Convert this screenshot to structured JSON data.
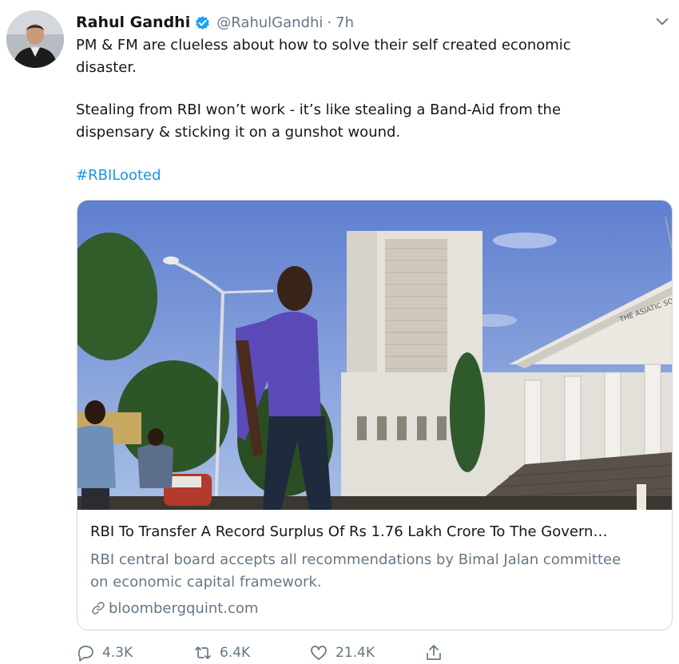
{
  "tweet": {
    "author_name": "Rahul Gandhi",
    "handle": "@RahulGandhi",
    "separator": "·",
    "time": "7h",
    "lines": [
      "PM & FM are clueless about how to solve their self created economic",
      "disaster.",
      "Stealing from RBI won’t work - it’s like stealing a Band-Aid from the",
      "dispensary & sticking it on a gunshot wound."
    ],
    "hashtag": "#RBILooted"
  },
  "card": {
    "title": "RBI To Transfer A Record Surplus Of Rs 1.76 Lakh Crore To The Govern…",
    "description_lines": [
      "RBI central board accepts all recommendations by Bimal Jalan committee",
      "on economic capital framework."
    ],
    "domain": "bloombergquint.com",
    "building_sign": "THE ASIATIC SOCIETY"
  },
  "actions": {
    "replies": "4.3K",
    "retweets": "6.4K",
    "likes": "21.4K"
  },
  "colors": {
    "link": "#1b95e0",
    "verified": "#1da1f2",
    "secondary_text": "#657786",
    "border": "#ccd6dd"
  },
  "icons": [
    "verified-badge-icon",
    "chevron-down-icon",
    "link-icon",
    "reply-icon",
    "retweet-icon",
    "like-icon",
    "share-icon"
  ]
}
